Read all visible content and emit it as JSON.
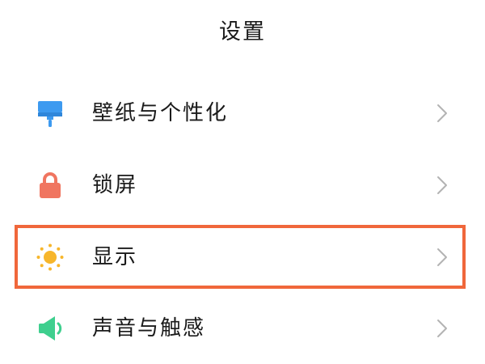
{
  "header": {
    "title": "设置"
  },
  "settings": {
    "items": [
      {
        "label": "壁纸与个性化",
        "icon": "paint-brush-icon",
        "icon_color": "#3d9af0"
      },
      {
        "label": "锁屏",
        "icon": "lock-icon",
        "icon_color": "#f07560"
      },
      {
        "label": "显示",
        "icon": "sun-icon",
        "icon_color": "#f7b62b"
      },
      {
        "label": "声音与触感",
        "icon": "speaker-icon",
        "icon_color": "#3ecf8e"
      }
    ],
    "chevron_icon": "chevron-right-icon"
  },
  "highlight": {
    "target": "显示",
    "color": "#f0673b"
  }
}
